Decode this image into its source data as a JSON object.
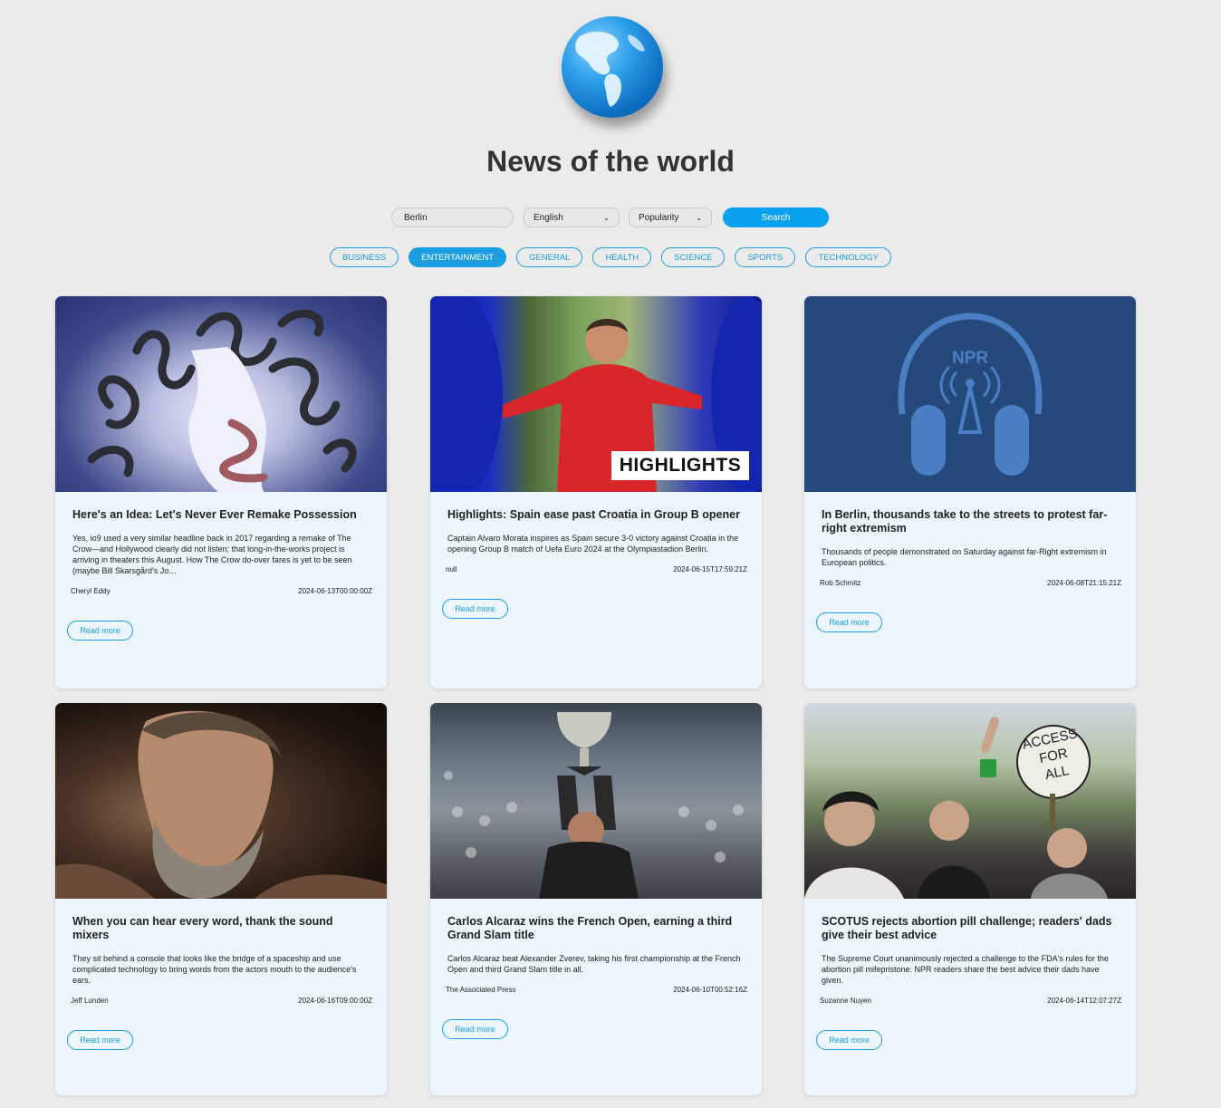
{
  "page": {
    "title": "News of the world"
  },
  "search": {
    "value": "Berlin",
    "language": "English",
    "sort": "Popularity",
    "button": "Search"
  },
  "categories": [
    "BUSINESS",
    "ENTERTAINMENT",
    "GENERAL",
    "HEALTH",
    "SCIENCE",
    "SPORTS",
    "TECHNOLOGY"
  ],
  "active_category": "ENTERTAINMENT",
  "overlay": {
    "highlights": "HIGHLIGHTS",
    "npr": "NPR",
    "access": [
      "ACCESS",
      "FOR",
      "ALL"
    ]
  },
  "articles": [
    {
      "title": "Here's an Idea: Let's Never Ever Remake Possession",
      "description": "Yes, io9 used a very similar headline back in 2017 regarding a remake of The Crow—and Hollywood clearly did not listen; that long-in-the-works project is arriving in theaters this August. How The Crow do-over fares is yet to be seen (maybe Bill Skarsgård's Jo…",
      "author": "Cheryl Eddy",
      "date": "2024-06-13T00:00:00Z",
      "read_more": "Read more"
    },
    {
      "title": "Highlights: Spain ease past Croatia in Group B opener",
      "description": "Captain Alvaro Morata inspires as Spain secure 3-0 victory against Croatia in the opening Group B match of Uefa Euro 2024 at the Olympiastadion Berlin.",
      "author": "null",
      "date": "2024-06-15T17:59:21Z",
      "read_more": "Read more"
    },
    {
      "title": "In Berlin, thousands take to the streets to protest far-right extremism",
      "description": "Thousands of people demonstrated on Saturday against far-Right extremism in European politics.",
      "author": "Rob Schmitz",
      "date": "2024-06-08T21:15:21Z",
      "read_more": "Read more"
    },
    {
      "title": "When you can hear every word, thank the sound mixers",
      "description": "They sit behind a console that looks like the bridge of a spaceship and use complicated technology to bring words from the actors mouth to the audience's ears.",
      "author": "Jeff Lunden",
      "date": "2024-06-16T09:00:00Z",
      "read_more": "Read more"
    },
    {
      "title": "Carlos Alcaraz wins the French Open, earning a third Grand Slam title",
      "description": "Carlos Alcaraz beat Alexander Zverev, taking his first championship at the French Open and third Grand Slam title in all.",
      "author": "The Associated Press",
      "date": "2024-06-10T00:52:16Z",
      "read_more": "Read more"
    },
    {
      "title": "SCOTUS rejects abortion pill challenge; readers' dads give their best advice",
      "description": "The Supreme Court unanimously rejected a challenge to the FDA's rules for the abortion pill mifepristone. NPR readers share the best advice their dads have given.",
      "author": "Suzanne Nuyen",
      "date": "2024-06-14T12:07:27Z",
      "read_more": "Read more"
    }
  ]
}
